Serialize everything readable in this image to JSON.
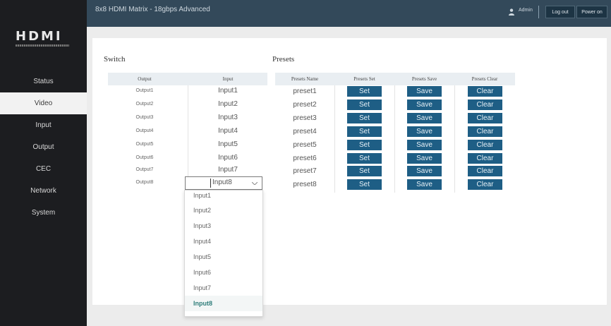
{
  "app": {
    "logo_text": "HDMI",
    "title": "8x8 HDMI Matrix - 18gbps Advanced",
    "user_name": "Admin",
    "logout_label": "Log out",
    "power_label": "Power on"
  },
  "sidebar": {
    "items": [
      {
        "label": "Status",
        "active": false
      },
      {
        "label": "Video",
        "active": true
      },
      {
        "label": "Input",
        "active": false
      },
      {
        "label": "Output",
        "active": false
      },
      {
        "label": "CEC",
        "active": false
      },
      {
        "label": "Network",
        "active": false
      },
      {
        "label": "System",
        "active": false
      }
    ]
  },
  "switch": {
    "title": "Switch",
    "headers": {
      "output": "Output",
      "input": "Input"
    },
    "rows": [
      {
        "output": "Output1",
        "input": "Input1"
      },
      {
        "output": "Output2",
        "input": "Input2"
      },
      {
        "output": "Output3",
        "input": "Input3"
      },
      {
        "output": "Output4",
        "input": "Input4"
      },
      {
        "output": "Output5",
        "input": "Input5"
      },
      {
        "output": "Output6",
        "input": "Input6"
      },
      {
        "output": "Output7",
        "input": "Input7"
      },
      {
        "output": "Output8",
        "input": "Input8"
      }
    ],
    "dropdown_options": [
      "Input1",
      "Input2",
      "Input3",
      "Input4",
      "Input5",
      "Input6",
      "Input7",
      "Input8"
    ],
    "dropdown_selected": "Input8"
  },
  "presets": {
    "title": "Presets",
    "headers": {
      "name": "Presets Name",
      "set": "Presets Set",
      "save": "Presets Save",
      "clear": "Presets Clear"
    },
    "rows": [
      {
        "name": "preset1",
        "set": "Set",
        "save": "Save",
        "clear": "Clear"
      },
      {
        "name": "preset2",
        "set": "Set",
        "save": "Save",
        "clear": "Clear"
      },
      {
        "name": "preset3",
        "set": "Set",
        "save": "Save",
        "clear": "Clear"
      },
      {
        "name": "preset4",
        "set": "Set",
        "save": "Save",
        "clear": "Clear"
      },
      {
        "name": "preset5",
        "set": "Set",
        "save": "Save",
        "clear": "Clear"
      },
      {
        "name": "preset6",
        "set": "Set",
        "save": "Save",
        "clear": "Clear"
      },
      {
        "name": "preset7",
        "set": "Set",
        "save": "Save",
        "clear": "Clear"
      },
      {
        "name": "preset8",
        "set": "Set",
        "save": "Save",
        "clear": "Clear"
      }
    ]
  },
  "colors": {
    "sidebar_bg": "#1c1d20",
    "topbar_bg": "#33495a",
    "button_blue": "#1e5e85",
    "selected_option": "#2e7d7a"
  },
  "icons": {
    "user": "user-icon",
    "dropdown_arrow": "chevron-down-icon"
  }
}
